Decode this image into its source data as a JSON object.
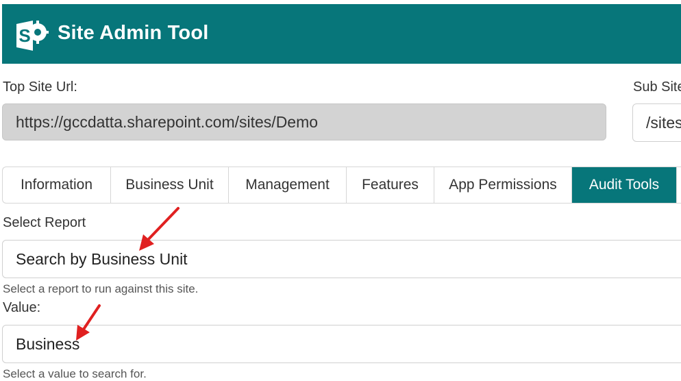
{
  "app": {
    "title": "Site Admin Tool",
    "logo_icon": "sharepoint-logo-icon",
    "header_color": "#07767a"
  },
  "site": {
    "top_site_label": "Top Site Url:",
    "top_site_value": "https://gccdatta.sharepoint.com/sites/Demo",
    "sub_site_label": "Sub Site",
    "sub_site_value": "/sites"
  },
  "tabs": [
    {
      "label": "Information",
      "active": false
    },
    {
      "label": "Business Unit",
      "active": false
    },
    {
      "label": "Management",
      "active": false
    },
    {
      "label": "Features",
      "active": false
    },
    {
      "label": "App Permissions",
      "active": false
    },
    {
      "label": "Audit Tools",
      "active": true
    }
  ],
  "report": {
    "label": "Select Report",
    "value": "Search by Business Unit",
    "help": "Select a report to run against this site."
  },
  "search_value": {
    "label": "Value:",
    "value": "Business",
    "help": "Select a value to search for."
  },
  "annotations": {
    "arrow_color": "#e02020",
    "arrow_icon": "red-arrow-annotation-icon"
  }
}
